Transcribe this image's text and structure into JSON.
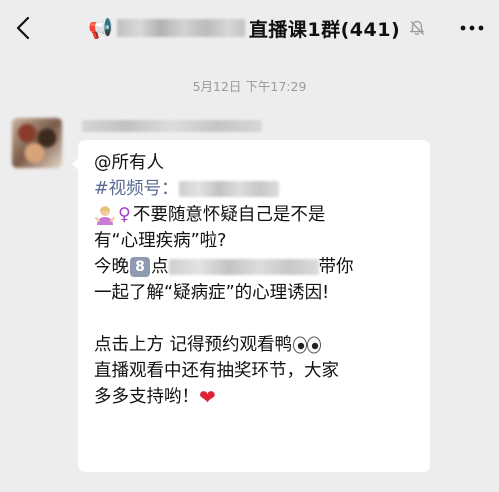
{
  "header": {
    "back_icon": "chevron-left-icon",
    "megaphone_icon": "📢",
    "title": "直播课1群(441)",
    "mute_icon": "bell-slash-icon",
    "more_icon": "more-dots-icon"
  },
  "chat": {
    "timestamp": "5月12日 下午17:29",
    "message": {
      "line1": "@所有人",
      "line2_tag": "#视频号：",
      "line3_text": "不要随意怀疑自己是不是",
      "line4": "有“心理疾病”啦?",
      "line5_prefix": "今晚",
      "line5_keycap": "8",
      "line5_char": "点",
      "line5_suffix": "带你",
      "line6": "一起了解“疑病症”的心理诱因!",
      "line7": "点击上方 记得预约观看鸭",
      "line8": "直播观看中还有抽奖环节，大家",
      "line9": "多多支持哟！",
      "heart": "❤",
      "female_sign": "♀"
    }
  }
}
